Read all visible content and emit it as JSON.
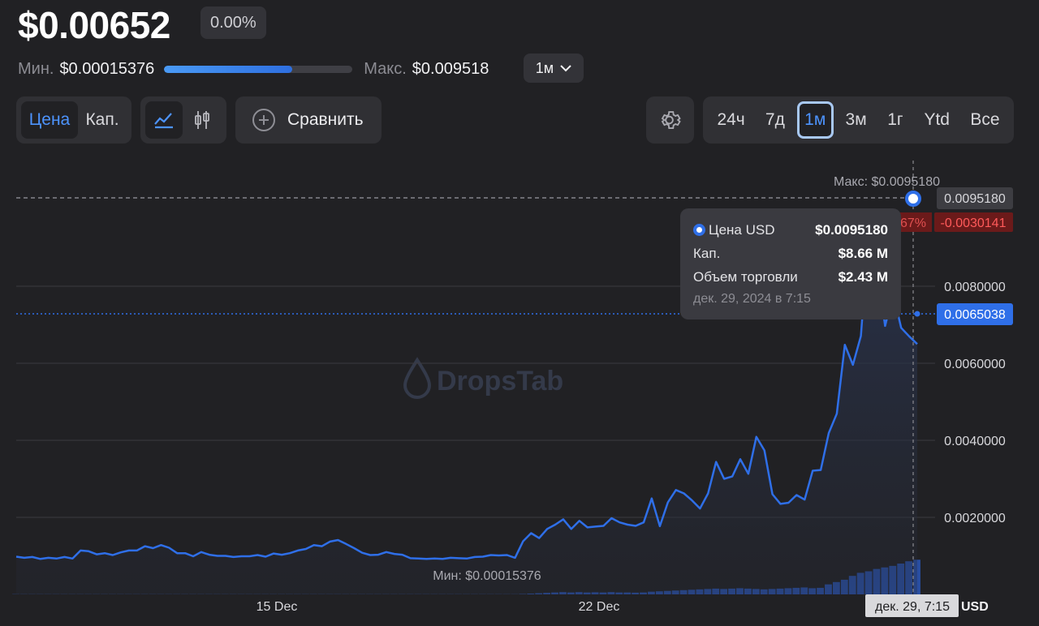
{
  "header": {
    "price": "$0.00652",
    "change": "0.00%",
    "min_label": "Мин.",
    "min_value": "$0.00015376",
    "max_label": "Макс.",
    "max_value": "$0.009518",
    "range_position": 0.68,
    "period": "1м"
  },
  "toolbar": {
    "metric_tabs": [
      "Цена",
      "Кап."
    ],
    "compare_label": "Сравнить",
    "timeframes": [
      "24ч",
      "7д",
      "1м",
      "3м",
      "1г",
      "Ytd",
      "Все"
    ],
    "active_timeframe": "1м"
  },
  "colors": {
    "accent": "#2f6fe8",
    "background": "#212124",
    "negative": "#b62222"
  },
  "chart_data": {
    "type": "line",
    "watermark": "DropsTab",
    "x_ticks": [
      "15 Dec",
      "22 Dec"
    ],
    "y_ticks": [
      "0.0020000",
      "0.0040000",
      "0.0060000",
      "0.0080000"
    ],
    "ylim": [
      0,
      0.0103
    ],
    "grid": true,
    "max_annotation": "Макс: $0.0095180",
    "min_annotation": "Мин: $0.00015376",
    "max_value_label": "0.0095180",
    "current_value_label": "0.0065038",
    "diff_label": "-0.0030141",
    "diff_pct_partial": "67%",
    "cursor_date_label": "дек. 29, 7:15",
    "currency": "USD",
    "series": [
      {
        "values": [
          0.00098,
          0.00095,
          0.00097,
          0.00092,
          0.00095,
          0.00093,
          0.00097,
          0.00093,
          0.00114,
          0.00112,
          0.00104,
          0.00107,
          0.00102,
          0.00109,
          0.00114,
          0.00114,
          0.00125,
          0.0012,
          0.00128,
          0.00121,
          0.00107,
          0.00107,
          0.00099,
          0.0011,
          0.00103,
          0.001,
          0.001,
          0.00097,
          0.00099,
          0.00099,
          0.00102,
          0.00098,
          0.00106,
          0.00103,
          0.00107,
          0.00114,
          0.00118,
          0.00128,
          0.00125,
          0.00137,
          0.00141,
          0.00131,
          0.0012,
          0.00108,
          0.00102,
          0.00103,
          0.0011,
          0.00105,
          0.00103,
          0.00094,
          0.00093,
          0.00092,
          0.00093,
          0.00092,
          0.00095,
          0.00094,
          0.00093,
          0.00097,
          0.00098,
          0.00102,
          0.00101,
          0.00102,
          0.00095,
          0.00138,
          0.00159,
          0.00146,
          0.0017,
          0.00181,
          0.00195,
          0.0017,
          0.00191,
          0.00174,
          0.00176,
          0.00178,
          0.00198,
          0.00187,
          0.00181,
          0.00178,
          0.00187,
          0.00249,
          0.00177,
          0.00239,
          0.00271,
          0.00262,
          0.00244,
          0.00223,
          0.00262,
          0.00344,
          0.003,
          0.00306,
          0.00351,
          0.00313,
          0.00409,
          0.00374,
          0.0026,
          0.00235,
          0.00238,
          0.00258,
          0.00246,
          0.00321,
          0.00323,
          0.00419,
          0.00469,
          0.00648,
          0.00596,
          0.00671,
          0.00954,
          0.00852,
          0.00697,
          0.00781,
          0.00692,
          0.0067,
          0.0065
        ],
        "volume": [
          5e-05,
          5e-05,
          5e-05,
          5e-05,
          5e-05,
          5e-05,
          5e-05,
          5e-05,
          5e-05,
          5e-05,
          5e-05,
          5e-05,
          5e-05,
          5e-05,
          5e-05,
          5e-05,
          5e-05,
          5e-05,
          5e-05,
          5e-05,
          5e-05,
          5e-05,
          5e-05,
          5e-05,
          5e-05,
          5e-05,
          5e-05,
          5e-05,
          5e-05,
          5e-05,
          5e-05,
          5e-05,
          5e-05,
          5e-05,
          5e-05,
          5e-05,
          5e-05,
          5e-05,
          5e-05,
          5e-05,
          5e-05,
          5e-05,
          5e-05,
          5e-05,
          5e-05,
          5e-05,
          5e-05,
          5e-05,
          5e-05,
          5e-05,
          5e-05,
          5e-05,
          5e-05,
          5e-05,
          5e-05,
          5e-05,
          5e-05,
          5e-05,
          5e-05,
          5e-05,
          5e-05,
          5e-05,
          5e-05,
          0.0001,
          0.0002,
          0.0003,
          0.0004,
          0.0005,
          0.0006,
          0.0005,
          0.0006,
          0.0005,
          0.00055,
          0.0005,
          0.0006,
          0.0005,
          0.0005,
          0.00045,
          0.0005,
          0.0007,
          0.0008,
          0.0009,
          0.001,
          0.0011,
          0.0012,
          0.0013,
          0.0014,
          0.0015,
          0.0014,
          0.0015,
          0.0016,
          0.0015,
          0.0014,
          0.0013,
          0.0014,
          0.0015,
          0.0016,
          0.0017,
          0.0018,
          0.0016,
          0.0017,
          0.0026,
          0.0032,
          0.0038,
          0.0048,
          0.0056,
          0.006,
          0.0066,
          0.007,
          0.0074,
          0.008,
          0.0086,
          0.009
        ]
      }
    ]
  }
}
